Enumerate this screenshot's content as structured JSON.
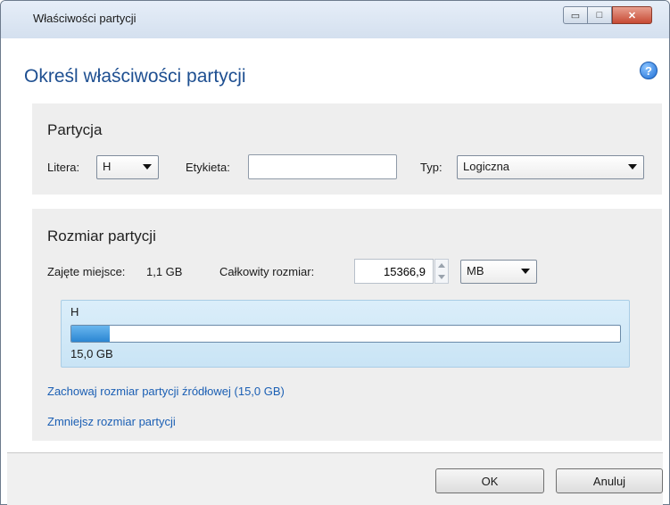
{
  "window": {
    "title": "Właściwości partycji",
    "minimize_glyph": "▭",
    "maximize_glyph": "□",
    "close_glyph": "✕"
  },
  "heading": "Określ właściwości partycji",
  "help_icon": {
    "name": "help-icon",
    "glyph": "?"
  },
  "partition": {
    "title": "Partycja",
    "letter_label": "Litera:",
    "letter_value": "H",
    "label_label": "Etykieta:",
    "label_value": "",
    "type_label": "Typ:",
    "type_value": "Logiczna"
  },
  "size": {
    "title": "Rozmiar partycji",
    "used_label": "Zajęte miejsce:",
    "used_value": "1,1 GB",
    "total_label": "Całkowity rozmiar:",
    "total_value": "15366,9",
    "unit_value": "MB",
    "disk_letter": "H",
    "disk_total": "15,0 GB",
    "used_fraction": 0.07,
    "link_keep": "Zachowaj rozmiar partycji źródłowej (15,0 GB)",
    "link_shrink": "Zmniejsz rozmiar partycji"
  },
  "buttons": {
    "ok": "OK",
    "cancel": "Anuluj"
  },
  "colors": {
    "accent": "#1e4f91",
    "link": "#1b5fb4",
    "bar_fill": "#2b86d3"
  }
}
